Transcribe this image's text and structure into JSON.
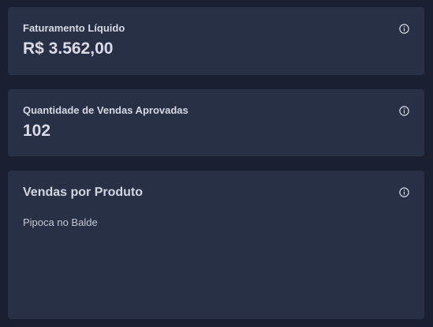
{
  "cards": {
    "net_revenue": {
      "label": "Faturamento Líquido",
      "value": "R$ 3.562,00",
      "icon": "info-icon"
    },
    "approved_sales": {
      "label": "Quantidade de Vendas Aprovadas",
      "value": "102",
      "icon": "info-icon"
    },
    "sales_by_product": {
      "title": "Vendas por Produto",
      "icon": "info-icon",
      "items": [
        "Pipoca no Balde"
      ]
    }
  },
  "colors": {
    "background": "#1a2031",
    "card": "#283046",
    "text": "#d6d9e2",
    "muted": "#c3c8d3"
  }
}
